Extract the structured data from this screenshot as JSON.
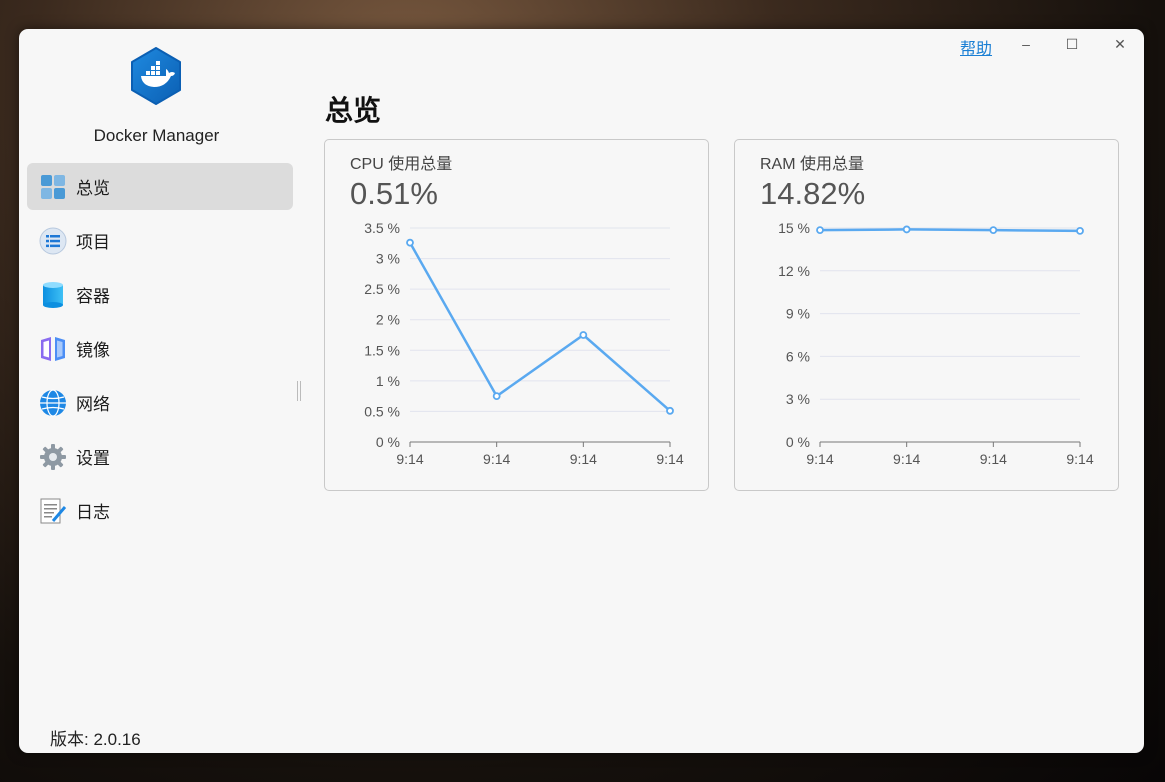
{
  "window": {
    "help_label": "帮助",
    "minimize_glyph": "–",
    "maximize_glyph": "☐",
    "close_glyph": "✕"
  },
  "sidebar": {
    "app_name": "Docker Manager",
    "items": [
      {
        "label": "总览",
        "icon": "overview-icon",
        "active": true
      },
      {
        "label": "项目",
        "icon": "projects-icon",
        "active": false
      },
      {
        "label": "容器",
        "icon": "containers-icon",
        "active": false
      },
      {
        "label": "镜像",
        "icon": "images-icon",
        "active": false
      },
      {
        "label": "网络",
        "icon": "network-icon",
        "active": false
      },
      {
        "label": "设置",
        "icon": "settings-icon",
        "active": false
      },
      {
        "label": "日志",
        "icon": "logs-icon",
        "active": false
      }
    ],
    "version": "版本: 2.0.16"
  },
  "main": {
    "title": "总览"
  },
  "colors": {
    "accent": "#1a7fd4",
    "line": "#5aa9f0",
    "grid": "#e2e4ee"
  },
  "chart_data": [
    {
      "type": "line",
      "title": "CPU 使用总量",
      "current_value": "0.51%",
      "x": [
        "9:14",
        "9:14",
        "9:14",
        "9:14"
      ],
      "series": [
        {
          "values": [
            3.26,
            0.75,
            1.75,
            0.51
          ]
        }
      ],
      "yticks": [
        "0 %",
        "0.5 %",
        "1 %",
        "1.5 %",
        "2 %",
        "2.5 %",
        "3 %",
        "3.5 %"
      ],
      "ylim": [
        0,
        3.5
      ],
      "ystep": 0.5,
      "grid": true
    },
    {
      "type": "line",
      "title": "RAM 使用总量",
      "current_value": "14.82%",
      "x": [
        "9:14",
        "9:14",
        "9:14",
        "9:14"
      ],
      "series": [
        {
          "values": [
            14.85,
            14.9,
            14.85,
            14.8
          ]
        }
      ],
      "yticks": [
        "0 %",
        "3 %",
        "6 %",
        "9 %",
        "12 %",
        "15 %"
      ],
      "ylim": [
        0,
        15
      ],
      "ystep": 3,
      "grid": true
    }
  ]
}
